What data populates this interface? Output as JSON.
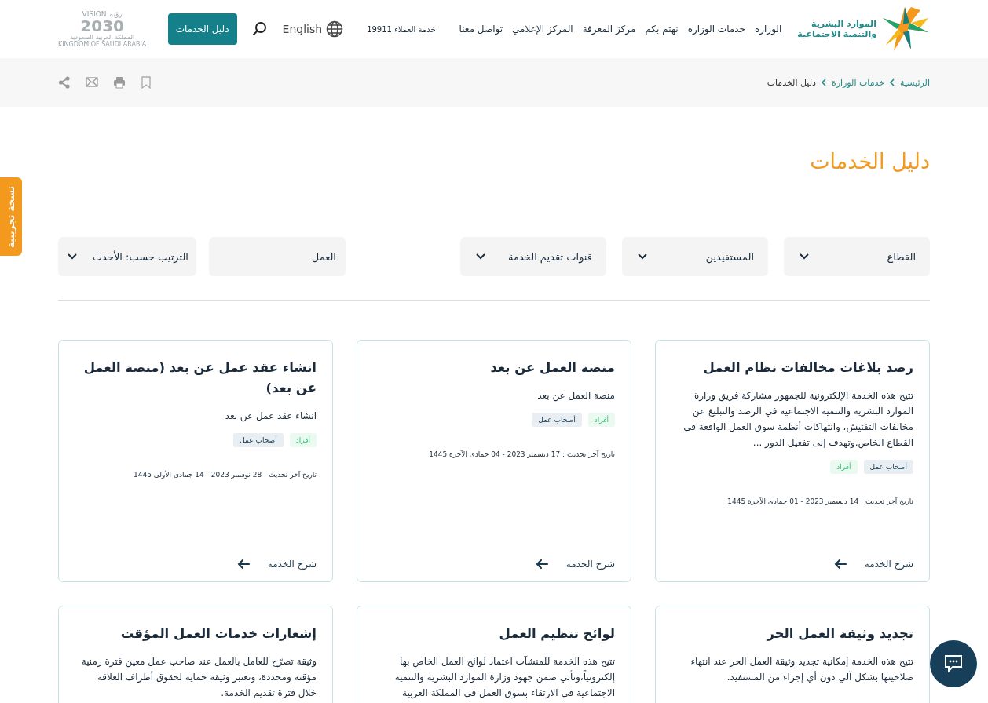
{
  "header": {
    "logo_lines": [
      "الموارد البشرية",
      "والتنمية الاجتماعية"
    ],
    "nav": [
      "الوزارة",
      "خدمات الوزارة",
      "نهتم بكم",
      "مركز المعرفة",
      "المركز الإعلامي",
      "تواصل معنا"
    ],
    "customer_service": "خدمة العملاء 19911",
    "language": "English",
    "services_button": "دليل الخدمات",
    "vision": {
      "arabic": "رؤية",
      "latin": "VISION",
      "year": "2030",
      "country_ar": "المملكة العربية السعودية",
      "country_en": "KINGDOM OF SAUDI ARABIA"
    }
  },
  "breadcrumb": [
    "الرئيسية",
    "خدمات الوزارة",
    "دليل الخدمات"
  ],
  "page_title": "دليل الخدمات",
  "beta_tab": "نسخة تجريبية",
  "filters": [
    {
      "kind": "dropdown",
      "label": "القطاع"
    },
    {
      "kind": "dropdown",
      "label": "المستفيدين"
    },
    {
      "kind": "dropdown",
      "label": "قنوات تقديم الخدمة"
    },
    {
      "kind": "search",
      "value": "العمل"
    },
    {
      "kind": "sort",
      "label": "الترتيب حسب: الأحدث"
    }
  ],
  "cards": [
    {
      "title": "رصد بلاغات مخالفات نظام العمل",
      "description": "تتيح هذه الخدمة الإلكترونية للجمهور مشاركة فريق وزارة الموارد البشرية والتنمية الاجتماعية في الرصد والتبليغ عن مخالفات التفتيش، وانتهاكات أنظمة سوق العمل الواقعة في القطاع الخاص.وتهدف إلى تفعيل الدور ...",
      "tags": [
        {
          "kind": "employers",
          "label": "أصحاب عمل"
        },
        {
          "kind": "individuals",
          "label": "أفراد"
        }
      ],
      "updated": "تاريخ آخر تحديث : 14 ديسمبر 2023 - 01 جمادى الآخرة 1445",
      "link": "شرح الخدمة"
    },
    {
      "title": "منصة العمل عن بعد",
      "description": "منصة العمل عن بعد",
      "tags": [
        {
          "kind": "individuals",
          "label": "أفراد"
        },
        {
          "kind": "employers",
          "label": "أصحاب عمل"
        }
      ],
      "updated": "تاريخ آخر تحديث : 17 ديسمبر 2023 - 04 جمادى الآخرة 1445",
      "link": "شرح الخدمة"
    },
    {
      "title": "انشاء عقد عمل عن بعد (منصة العمل عن بعد)",
      "description": "انشاء عقد عمل عن بعد",
      "tags": [
        {
          "kind": "individuals",
          "label": "أفراد"
        },
        {
          "kind": "employers",
          "label": "أصحاب عمل"
        }
      ],
      "updated": "تاريخ آخر تحديث : 28 نوفمبر 2023 - 14 جمادى الأولى 1445",
      "link": "شرح الخدمة"
    },
    {
      "title": "تجديد وثيقة العمل الحر",
      "description": "تتيح هذه الخدمة إمكانية تجديد وثيقة العمل الحر عند انتهاء صلاحيتها بشكل آلي دون أي إجراء من المستفيد."
    },
    {
      "title": "لوائح تنظيم العمل",
      "description": "تتيح هذه الخدمة للمنشآت اعتماد لوائح العمل الخاص بها إلكترونياً،وتأتي ضمن جهود وزارة الموارد البشرية والتنمية الاجتماعية في الارتقاء بسوق العمل في المملكة العربية"
    },
    {
      "title": "إشعارات خدمات العمل المؤقت",
      "description": "وثيقة تصرّح للعامل بالعمل عند صاحب عمل معين فترة زمنية مؤقتة ومحددة، وتعتبر وثيقة حماية لحقوق أطراف العلاقة خلال فترة تقديم الخدمة."
    }
  ]
}
